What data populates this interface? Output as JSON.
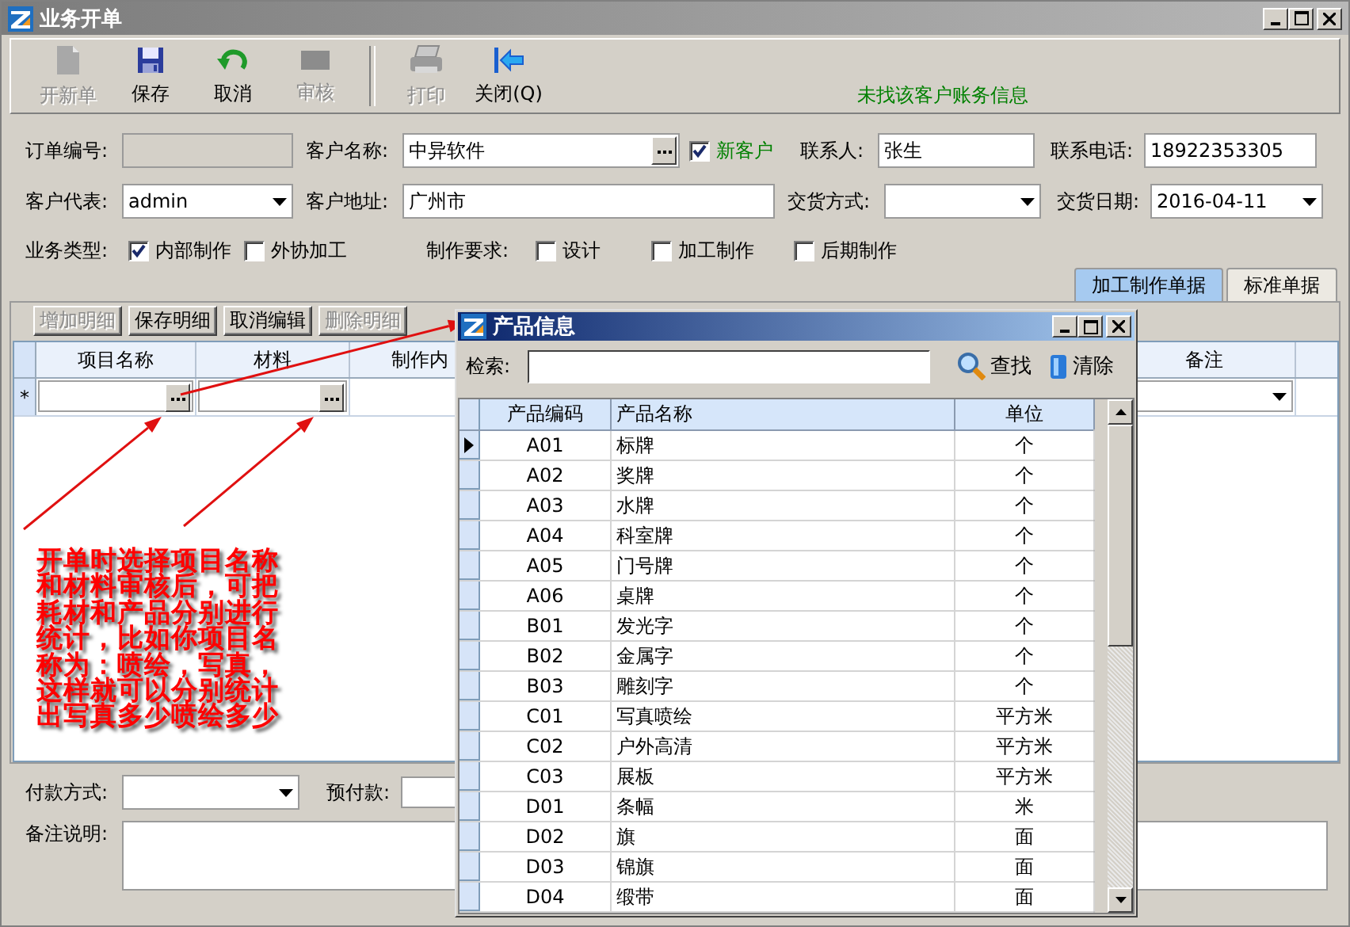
{
  "window": {
    "title": "业务开单"
  },
  "toolbar": [
    {
      "label": "开新单",
      "kind": "new",
      "disabled": true
    },
    {
      "label": "保存",
      "kind": "save",
      "disabled": false
    },
    {
      "label": "取消",
      "kind": "undo",
      "disabled": false
    },
    {
      "label": "审核",
      "kind": "audit",
      "disabled": true
    },
    {
      "label": "打印",
      "kind": "print",
      "disabled": true
    },
    {
      "label": "关闭(Q)",
      "kind": "close",
      "disabled": false
    }
  ],
  "notice": "未找该客户账务信息",
  "form": {
    "order_no": {
      "label": "订单编号:",
      "disabled": true
    },
    "customer_name": {
      "label": "客户名称:",
      "value": "中异软件"
    },
    "new_customer": {
      "label": "新客户",
      "checked": true
    },
    "contact": {
      "label": "联系人:",
      "value": "张生"
    },
    "phone": {
      "label": "联系电话:",
      "value": "18922353305"
    },
    "rep": {
      "label": "客户代表:",
      "value": "admin"
    },
    "address": {
      "label": "客户地址:",
      "value": "广州市"
    },
    "delivery_method": {
      "label": "交货方式:"
    },
    "delivery_date": {
      "label": "交货日期:",
      "value": "2016-04-11"
    },
    "business_type": {
      "label": "业务类型:",
      "options": [
        {
          "label": "内部制作",
          "checked": true
        },
        {
          "label": "外协加工",
          "checked": false
        }
      ]
    },
    "requirements": {
      "label": "制作要求:",
      "options": [
        {
          "label": "设计",
          "checked": false
        },
        {
          "label": "加工制作",
          "checked": false
        },
        {
          "label": "后期制作",
          "checked": false
        }
      ]
    }
  },
  "tabs": [
    {
      "label": "加工制作单据",
      "selected": true
    },
    {
      "label": "标准单据",
      "selected": false
    }
  ],
  "detail_buttons": [
    {
      "label": "增加明细",
      "disabled": true
    },
    {
      "label": "保存明细",
      "disabled": false
    },
    {
      "label": "取消编辑",
      "disabled": false
    },
    {
      "label": "删除明细",
      "disabled": true
    }
  ],
  "detail_table": {
    "columns": [
      "项目名称",
      "材料",
      "制作内",
      "备注"
    ],
    "new_row_marker": "*"
  },
  "annotation": "开单时选择项目名称和材料审核后，可把耗材和产品分别进行统计，比如你项目名称为：喷绘，写真，这样就可以分别统计出写真多少喷绘多少",
  "payment": {
    "label": "付款方式:"
  },
  "prepay": {
    "label": "预付款:"
  },
  "remarks": {
    "label": "备注说明:"
  },
  "dialog": {
    "title": "产品信息",
    "search_label": "检索:",
    "find": "查找",
    "clear": "清除",
    "columns": [
      "产品编码",
      "产品名称",
      "单位"
    ],
    "rows": [
      {
        "code": "A01",
        "name": "标牌",
        "unit": "个",
        "selected": true
      },
      {
        "code": "A02",
        "name": "奖牌",
        "unit": "个",
        "selected": false
      },
      {
        "code": "A03",
        "name": "水牌",
        "unit": "个",
        "selected": false
      },
      {
        "code": "A04",
        "name": "科室牌",
        "unit": "个",
        "selected": false
      },
      {
        "code": "A05",
        "name": "门号牌",
        "unit": "个",
        "selected": false
      },
      {
        "code": "A06",
        "name": "桌牌",
        "unit": "个",
        "selected": false
      },
      {
        "code": "B01",
        "name": "发光字",
        "unit": "个",
        "selected": false
      },
      {
        "code": "B02",
        "name": "金属字",
        "unit": "个",
        "selected": false
      },
      {
        "code": "B03",
        "name": "雕刻字",
        "unit": "个",
        "selected": false
      },
      {
        "code": "C01",
        "name": "写真喷绘",
        "unit": "平方米",
        "selected": false
      },
      {
        "code": "C02",
        "name": "户外高清",
        "unit": "平方米",
        "selected": false
      },
      {
        "code": "C03",
        "name": "展板",
        "unit": "平方米",
        "selected": false
      },
      {
        "code": "D01",
        "name": "条幅",
        "unit": "米",
        "selected": false
      },
      {
        "code": "D02",
        "name": "旗",
        "unit": "面",
        "selected": false
      },
      {
        "code": "D03",
        "name": "锦旗",
        "unit": "面",
        "selected": false
      },
      {
        "code": "D04",
        "name": "缎带",
        "unit": "面",
        "selected": false
      }
    ]
  }
}
